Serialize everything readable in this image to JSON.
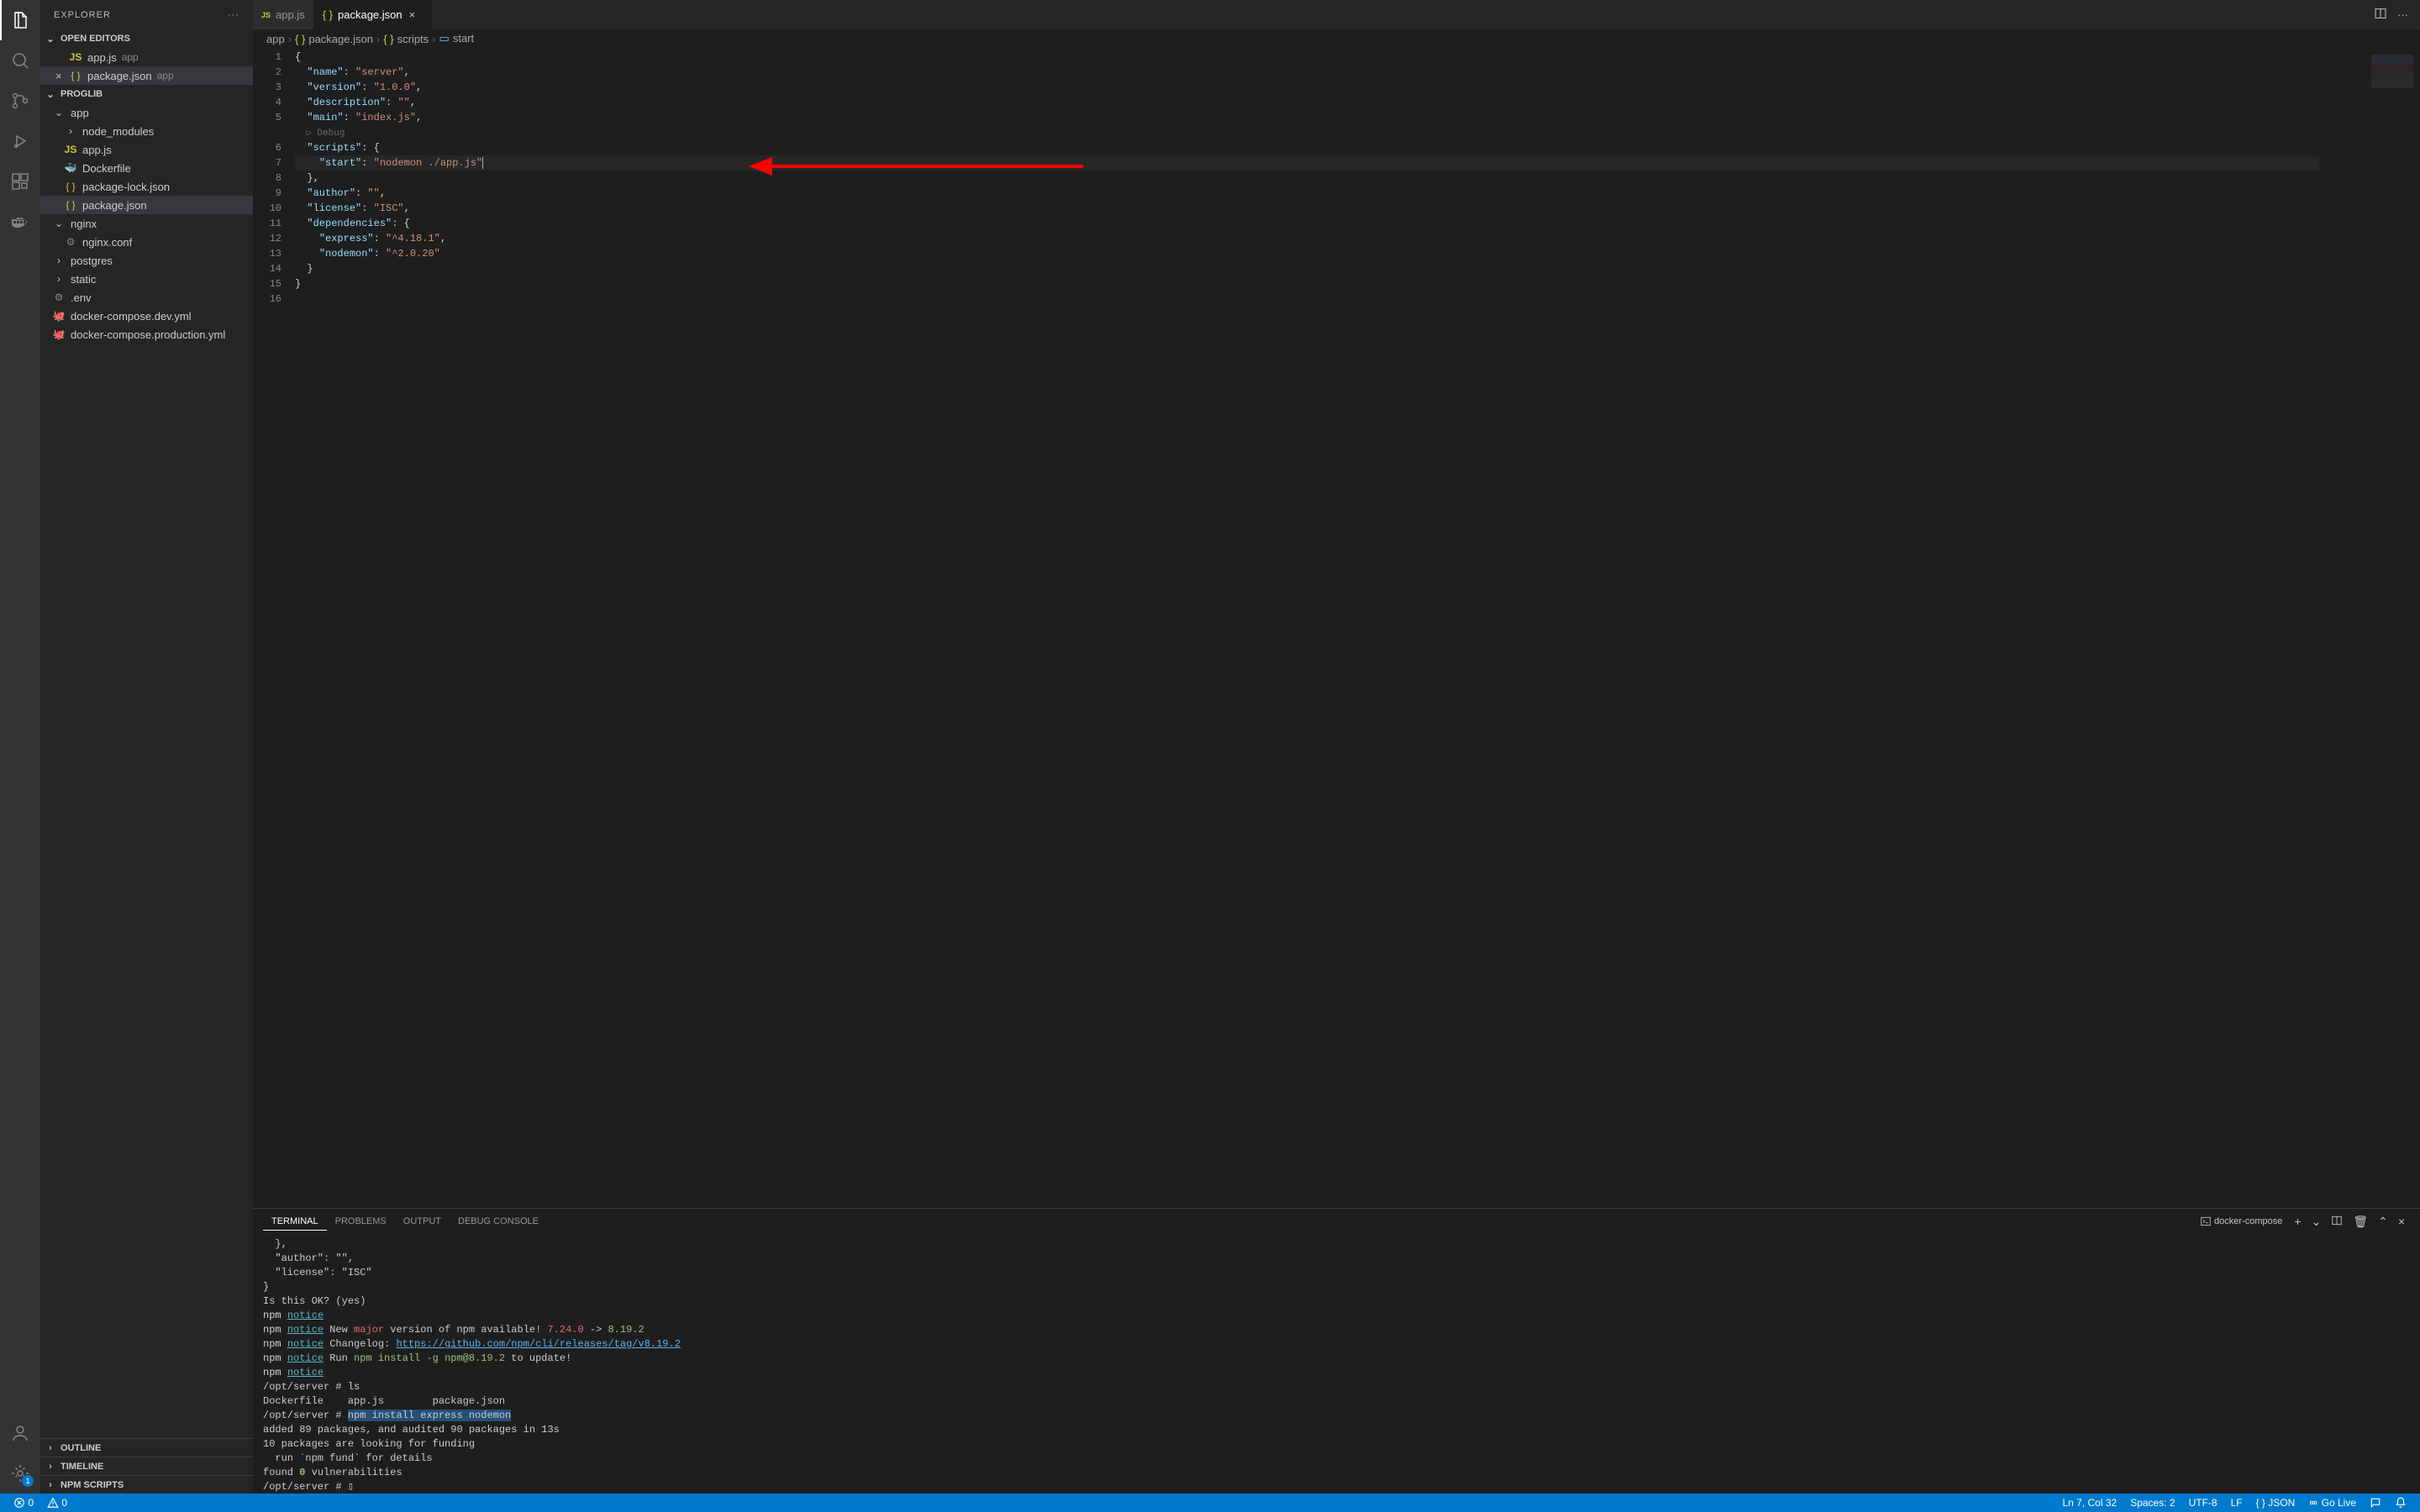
{
  "sidebar": {
    "title": "EXPLORER",
    "sections": {
      "open_editors": {
        "title": "OPEN EDITORS",
        "items": [
          {
            "label": "app.js",
            "dir": "app",
            "icon": "js"
          },
          {
            "label": "package.json",
            "dir": "app",
            "icon": "json",
            "active": true
          }
        ]
      },
      "workspace": {
        "title": "PROGLIB",
        "tree": [
          {
            "label": "app",
            "type": "folder",
            "expanded": true,
            "depth": 0
          },
          {
            "label": "node_modules",
            "type": "folder",
            "expanded": false,
            "depth": 1
          },
          {
            "label": "app.js",
            "type": "file",
            "icon": "js",
            "depth": 1
          },
          {
            "label": "Dockerfile",
            "type": "file",
            "icon": "docker",
            "depth": 1
          },
          {
            "label": "package-lock.json",
            "type": "file",
            "icon": "json",
            "depth": 1
          },
          {
            "label": "package.json",
            "type": "file",
            "icon": "json",
            "depth": 1,
            "active": true
          },
          {
            "label": "nginx",
            "type": "folder",
            "expanded": true,
            "depth": 0
          },
          {
            "label": "nginx.conf",
            "type": "file",
            "icon": "nginx",
            "depth": 1
          },
          {
            "label": "postgres",
            "type": "folder",
            "expanded": false,
            "depth": 0
          },
          {
            "label": "static",
            "type": "folder",
            "expanded": false,
            "depth": 0
          },
          {
            "label": ".env",
            "type": "file",
            "icon": "gear",
            "depth": 0
          },
          {
            "label": "docker-compose.dev.yml",
            "type": "file",
            "icon": "compose",
            "depth": 0
          },
          {
            "label": "docker-compose.production.yml",
            "type": "file",
            "icon": "compose",
            "depth": 0
          }
        ]
      },
      "outline": {
        "title": "OUTLINE"
      },
      "timeline": {
        "title": "TIMELINE"
      },
      "npm_scripts": {
        "title": "NPM SCRIPTS"
      }
    }
  },
  "tabs": [
    {
      "label": "app.js",
      "icon": "js",
      "active": false
    },
    {
      "label": "package.json",
      "icon": "json",
      "active": true,
      "closable": true
    }
  ],
  "breadcrumb": [
    "app",
    "package.json",
    "scripts",
    "start"
  ],
  "editor": {
    "lines": [
      {
        "n": 1,
        "tokens": [
          [
            "punc",
            "{"
          ]
        ]
      },
      {
        "n": 2,
        "tokens": [
          [
            "punc",
            "  "
          ],
          [
            "key",
            "\"name\""
          ],
          [
            "punc",
            ": "
          ],
          [
            "str",
            "\"server\""
          ],
          [
            "punc",
            ","
          ]
        ]
      },
      {
        "n": 3,
        "tokens": [
          [
            "punc",
            "  "
          ],
          [
            "key",
            "\"version\""
          ],
          [
            "punc",
            ": "
          ],
          [
            "str",
            "\"1.0.0\""
          ],
          [
            "punc",
            ","
          ]
        ]
      },
      {
        "n": 4,
        "tokens": [
          [
            "punc",
            "  "
          ],
          [
            "key",
            "\"description\""
          ],
          [
            "punc",
            ": "
          ],
          [
            "str",
            "\"\""
          ],
          [
            "punc",
            ","
          ]
        ]
      },
      {
        "n": 5,
        "tokens": [
          [
            "punc",
            "  "
          ],
          [
            "key",
            "\"main\""
          ],
          [
            "punc",
            ": "
          ],
          [
            "str",
            "\"index.js\""
          ],
          [
            "punc",
            ","
          ]
        ]
      },
      {
        "n": 0,
        "hint": "  ▷ Debug"
      },
      {
        "n": 6,
        "tokens": [
          [
            "punc",
            "  "
          ],
          [
            "key",
            "\"scripts\""
          ],
          [
            "punc",
            ": {"
          ]
        ]
      },
      {
        "n": 7,
        "hl": true,
        "tokens": [
          [
            "punc",
            "    "
          ],
          [
            "key",
            "\"start\""
          ],
          [
            "punc",
            ": "
          ],
          [
            "str",
            "\"nodemon ./app.js\""
          ]
        ],
        "cursor": true
      },
      {
        "n": 8,
        "tokens": [
          [
            "punc",
            "  },"
          ]
        ]
      },
      {
        "n": 9,
        "tokens": [
          [
            "punc",
            "  "
          ],
          [
            "key",
            "\"author\""
          ],
          [
            "punc",
            ": "
          ],
          [
            "str",
            "\"\""
          ],
          [
            "punc",
            ","
          ]
        ]
      },
      {
        "n": 10,
        "tokens": [
          [
            "punc",
            "  "
          ],
          [
            "key",
            "\"license\""
          ],
          [
            "punc",
            ": "
          ],
          [
            "str",
            "\"ISC\""
          ],
          [
            "punc",
            ","
          ]
        ]
      },
      {
        "n": 11,
        "tokens": [
          [
            "punc",
            "  "
          ],
          [
            "key",
            "\"dependencies\""
          ],
          [
            "punc",
            ": {"
          ]
        ]
      },
      {
        "n": 12,
        "tokens": [
          [
            "punc",
            "    "
          ],
          [
            "key",
            "\"express\""
          ],
          [
            "punc",
            ": "
          ],
          [
            "str",
            "\"^4.18.1\""
          ],
          [
            "punc",
            ","
          ]
        ]
      },
      {
        "n": 13,
        "tokens": [
          [
            "punc",
            "    "
          ],
          [
            "key",
            "\"nodemon\""
          ],
          [
            "punc",
            ": "
          ],
          [
            "str",
            "\"^2.0.20\""
          ]
        ]
      },
      {
        "n": 14,
        "tokens": [
          [
            "punc",
            "  }"
          ]
        ]
      },
      {
        "n": 15,
        "tokens": [
          [
            "punc",
            "}"
          ]
        ]
      },
      {
        "n": 16,
        "tokens": [
          [
            "punc",
            ""
          ]
        ]
      }
    ]
  },
  "panel": {
    "tabs": [
      "TERMINAL",
      "PROBLEMS",
      "OUTPUT",
      "DEBUG CONSOLE"
    ],
    "active_tab": "TERMINAL",
    "terminal_label": "docker-compose"
  },
  "terminal_lines": [
    {
      "segs": [
        [
          "plain",
          "  },"
        ]
      ]
    },
    {
      "segs": [
        [
          "plain",
          "  \"author\": \"\","
        ]
      ]
    },
    {
      "segs": [
        [
          "plain",
          "  \"license\": \"ISC\""
        ]
      ]
    },
    {
      "segs": [
        [
          "plain",
          "}"
        ]
      ]
    },
    {
      "segs": [
        [
          "plain",
          ""
        ]
      ]
    },
    {
      "segs": [
        [
          "plain",
          ""
        ]
      ]
    },
    {
      "segs": [
        [
          "plain",
          "Is this OK? (yes)"
        ]
      ]
    },
    {
      "segs": [
        [
          "npm",
          "npm "
        ],
        [
          "notice",
          "notice"
        ]
      ]
    },
    {
      "segs": [
        [
          "npm",
          "npm "
        ],
        [
          "notice",
          "notice"
        ],
        [
          "plain",
          " New "
        ],
        [
          "major",
          "major"
        ],
        [
          "plain",
          " version of npm available! "
        ],
        [
          "ver-old",
          "7.24.0"
        ],
        [
          "plain",
          " -> "
        ],
        [
          "ver-new",
          "8.19.2"
        ]
      ]
    },
    {
      "segs": [
        [
          "npm",
          "npm "
        ],
        [
          "notice",
          "notice"
        ],
        [
          "plain",
          " Changelog: "
        ],
        [
          "url",
          "https://github.com/npm/cli/releases/tag/v8.19.2"
        ]
      ]
    },
    {
      "segs": [
        [
          "npm",
          "npm "
        ],
        [
          "notice",
          "notice"
        ],
        [
          "plain",
          " Run "
        ],
        [
          "cmd",
          "npm install -g npm@8.19.2"
        ],
        [
          "plain",
          " to update!"
        ]
      ]
    },
    {
      "segs": [
        [
          "npm",
          "npm "
        ],
        [
          "notice",
          "notice"
        ]
      ]
    },
    {
      "segs": [
        [
          "plain",
          "/opt/server # ls"
        ]
      ]
    },
    {
      "segs": [
        [
          "plain",
          "Dockerfile    app.js        package.json"
        ]
      ]
    },
    {
      "segs": [
        [
          "plain",
          "/opt/server # "
        ],
        [
          "hl",
          "npm install express nodemon"
        ]
      ]
    },
    {
      "segs": [
        [
          "plain",
          ""
        ]
      ]
    },
    {
      "segs": [
        [
          "plain",
          "added 89 packages, and audited 90 packages in 13s"
        ]
      ]
    },
    {
      "segs": [
        [
          "plain",
          ""
        ]
      ]
    },
    {
      "segs": [
        [
          "plain",
          "10 packages are looking for funding"
        ]
      ]
    },
    {
      "segs": [
        [
          "plain",
          "  run `npm fund` for details"
        ]
      ]
    },
    {
      "segs": [
        [
          "plain",
          ""
        ]
      ]
    },
    {
      "segs": [
        [
          "plain",
          "found "
        ],
        [
          "zero",
          "0"
        ],
        [
          "plain",
          " vulnerabilities"
        ]
      ]
    },
    {
      "segs": [
        [
          "plain",
          "/opt/server # ▯"
        ]
      ]
    }
  ],
  "statusbar": {
    "errors": "0",
    "warnings": "0",
    "cursor": "Ln 7, Col 32",
    "spaces": "Spaces: 2",
    "encoding": "UTF-8",
    "eol": "LF",
    "lang": "JSON",
    "golive": "Go Live"
  },
  "activity_badge": "1"
}
